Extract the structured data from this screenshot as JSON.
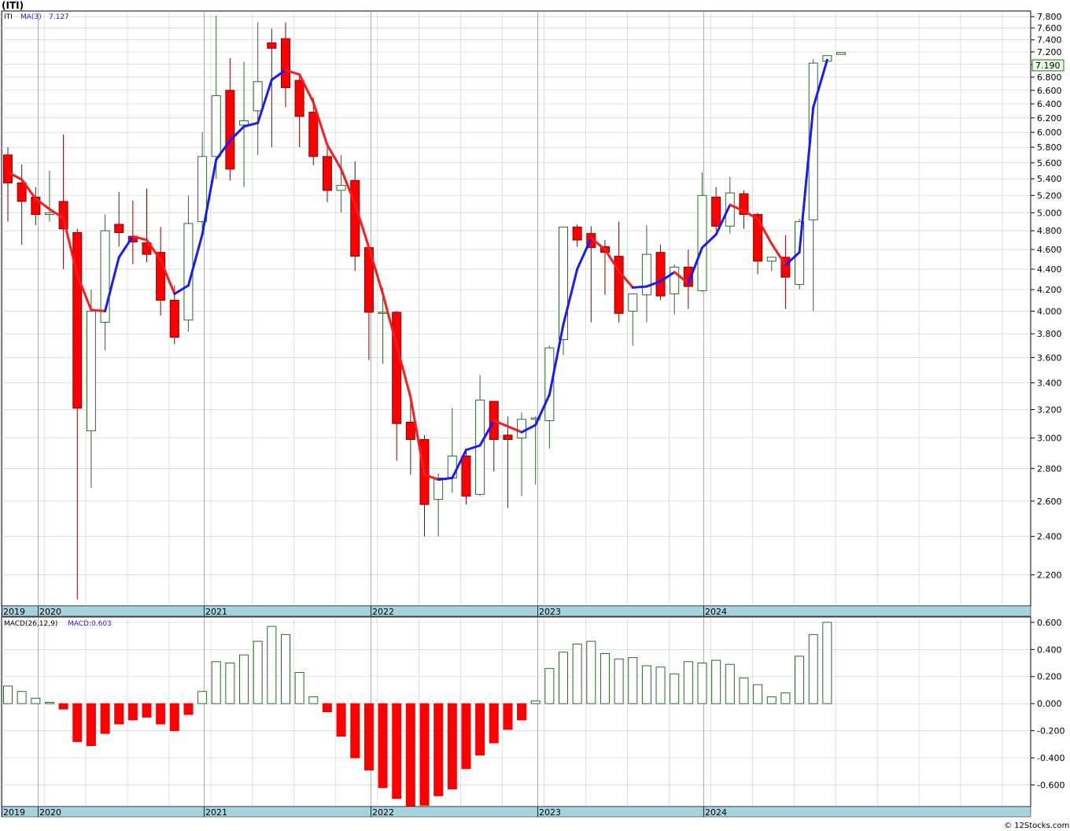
{
  "symbol_title": "(ITI)",
  "watermark": "© 12Stocks.com",
  "colors": {
    "up_body": "#ffffff",
    "up_border": "#2a6b2a",
    "down_body": "#ff0000",
    "ma_down": "#ff1a1a",
    "ma_up": "#1a1aff",
    "macd_pos": "#2a6b2a",
    "macd_neg": "#ff0000",
    "axis_band": "#a7d3e0",
    "grid": "#cccccc",
    "last_price_box": "#e8ffe8"
  },
  "price_legend": {
    "symbol": "ITI",
    "ma_label": "MA(3)",
    "ma_value": "7.127"
  },
  "price_badge": "7.190",
  "macd_legend": {
    "label": "MACD(26,12,9)",
    "value_label": "MACD:0.603"
  },
  "chart_data": [
    {
      "type": "candlestick",
      "series_name": "ITI",
      "period": "monthly",
      "start": "2019-11",
      "y_scale": "log",
      "ylim": [
        2.05,
        7.9
      ],
      "y_ticks": [
        "2.200",
        "2.400",
        "2.600",
        "2.800",
        "3.000",
        "3.200",
        "3.400",
        "3.600",
        "3.800",
        "4.000",
        "4.200",
        "4.400",
        "4.600",
        "4.800",
        "5.000",
        "5.200",
        "5.400",
        "5.600",
        "5.800",
        "6.000",
        "6.200",
        "6.400",
        "6.600",
        "6.800",
        "7.000",
        "7.200",
        "7.400",
        "7.600",
        "7.800"
      ],
      "x_ticks": [
        "2019",
        "2020",
        "2021",
        "2022",
        "2023",
        "2024"
      ],
      "ohlc": [
        [
          5.7,
          5.8,
          4.9,
          5.35
        ],
        [
          5.35,
          5.58,
          4.65,
          5.13
        ],
        [
          5.18,
          5.3,
          4.86,
          4.98
        ],
        [
          4.98,
          5.5,
          4.9,
          5.0
        ],
        [
          5.13,
          5.97,
          4.4,
          4.82
        ],
        [
          4.78,
          4.82,
          2.08,
          3.21
        ],
        [
          3.05,
          4.2,
          2.68,
          4.0
        ],
        [
          3.9,
          4.98,
          3.66,
          4.8
        ],
        [
          4.87,
          5.24,
          4.63,
          4.78
        ],
        [
          4.74,
          5.14,
          4.45,
          4.68
        ],
        [
          4.67,
          5.28,
          4.47,
          4.55
        ],
        [
          4.57,
          4.84,
          3.96,
          4.1
        ],
        [
          4.1,
          4.24,
          3.71,
          3.77
        ],
        [
          3.92,
          5.2,
          3.82,
          4.88
        ],
        [
          4.9,
          6.0,
          4.82,
          5.68
        ],
        [
          5.68,
          7.82,
          5.4,
          6.52
        ],
        [
          6.6,
          7.1,
          5.38,
          5.52
        ],
        [
          6.1,
          7.04,
          5.3,
          6.16
        ],
        [
          6.3,
          7.7,
          5.7,
          6.73
        ],
        [
          7.35,
          7.59,
          5.8,
          7.26
        ],
        [
          7.42,
          7.7,
          6.35,
          6.64
        ],
        [
          6.75,
          6.85,
          5.8,
          6.22
        ],
        [
          6.28,
          6.49,
          5.57,
          5.68
        ],
        [
          5.68,
          5.8,
          5.12,
          5.26
        ],
        [
          5.26,
          5.7,
          5.0,
          5.32
        ],
        [
          5.38,
          5.62,
          4.38,
          4.53
        ],
        [
          4.62,
          4.66,
          3.58,
          3.99
        ],
        [
          3.99,
          4.22,
          3.55,
          3.99
        ],
        [
          3.99,
          4.0,
          2.85,
          3.1
        ],
        [
          3.11,
          3.32,
          2.76,
          2.99
        ],
        [
          2.99,
          3.02,
          2.4,
          2.58
        ],
        [
          2.61,
          2.77,
          2.4,
          2.74
        ],
        [
          2.74,
          3.21,
          2.65,
          2.88
        ],
        [
          2.88,
          2.91,
          2.58,
          2.63
        ],
        [
          2.64,
          3.46,
          2.63,
          3.27
        ],
        [
          3.26,
          3.23,
          2.78,
          2.99
        ],
        [
          3.02,
          3.15,
          2.56,
          2.99
        ],
        [
          3.0,
          3.18,
          2.63,
          3.13
        ],
        [
          3.13,
          3.15,
          2.7,
          3.14
        ],
        [
          3.12,
          3.7,
          2.93,
          3.68
        ],
        [
          3.75,
          4.84,
          3.62,
          4.84
        ],
        [
          4.84,
          4.87,
          4.63,
          4.7
        ],
        [
          4.77,
          4.85,
          3.9,
          4.62
        ],
        [
          4.63,
          4.7,
          4.15,
          4.57
        ],
        [
          4.53,
          4.9,
          3.9,
          3.98
        ],
        [
          4.0,
          4.08,
          3.7,
          4.16
        ],
        [
          4.15,
          4.86,
          3.9,
          4.55
        ],
        [
          4.57,
          4.65,
          4.1,
          4.14
        ],
        [
          4.16,
          4.45,
          3.97,
          4.42
        ],
        [
          4.42,
          4.6,
          4.02,
          4.23
        ],
        [
          4.19,
          5.48,
          4.18,
          5.2
        ],
        [
          5.18,
          5.3,
          4.8,
          4.85
        ],
        [
          4.85,
          5.42,
          4.77,
          5.23
        ],
        [
          5.22,
          5.26,
          4.82,
          4.98
        ],
        [
          4.98,
          5.0,
          4.35,
          4.48
        ],
        [
          4.48,
          4.52,
          4.38,
          4.52
        ],
        [
          4.52,
          4.75,
          4.02,
          4.32
        ],
        [
          4.25,
          4.93,
          4.2,
          4.9
        ],
        [
          4.92,
          7.08,
          4.0,
          7.02
        ],
        [
          7.05,
          7.14,
          7.05,
          7.14
        ],
        [
          7.16,
          7.19,
          7.16,
          7.19
        ]
      ],
      "ma3": [
        5.48,
        5.39,
        5.16,
        5.04,
        4.94,
        4.34,
        4.01,
        4.0,
        4.52,
        4.74,
        4.7,
        4.49,
        4.16,
        4.24,
        4.76,
        5.64,
        5.89,
        6.08,
        6.13,
        6.76,
        6.91,
        6.84,
        6.42,
        5.83,
        5.52,
        5.1,
        4.62,
        4.16,
        3.7,
        3.29,
        2.76,
        2.73,
        2.74,
        2.92,
        2.95,
        3.12,
        3.08,
        3.04,
        3.09,
        3.31,
        3.88,
        4.4,
        4.72,
        4.6,
        4.38,
        4.22,
        4.23,
        4.28,
        4.37,
        4.26,
        4.62,
        4.76,
        5.09,
        5.02,
        4.93,
        4.66,
        4.44,
        4.57,
        6.35,
        7.07
      ],
      "ma3_start_index": 0
    },
    {
      "type": "bar",
      "series_name": "MACD(26,12,9)",
      "ylim": [
        -0.76,
        0.64
      ],
      "y_ticks": [
        "-0.600",
        "-0.400",
        "-0.200",
        "0.000",
        "0.200",
        "0.400",
        "0.600"
      ],
      "x_ticks": [
        "2019",
        "2020",
        "2021",
        "2022",
        "2023",
        "2024"
      ],
      "values": [
        0.13,
        0.09,
        0.04,
        0.01,
        -0.04,
        -0.28,
        -0.31,
        -0.22,
        -0.15,
        -0.12,
        -0.1,
        -0.15,
        -0.2,
        -0.08,
        0.09,
        0.31,
        0.3,
        0.36,
        0.46,
        0.57,
        0.51,
        0.23,
        0.05,
        -0.06,
        -0.24,
        -0.4,
        -0.49,
        -0.62,
        -0.7,
        -0.76,
        -0.75,
        -0.68,
        -0.63,
        -0.48,
        -0.38,
        -0.29,
        -0.19,
        -0.12,
        0.02,
        0.26,
        0.38,
        0.44,
        0.46,
        0.37,
        0.33,
        0.34,
        0.28,
        0.27,
        0.22,
        0.31,
        0.3,
        0.32,
        0.29,
        0.19,
        0.14,
        0.05,
        0.08,
        0.35,
        0.51,
        0.6
      ]
    }
  ]
}
